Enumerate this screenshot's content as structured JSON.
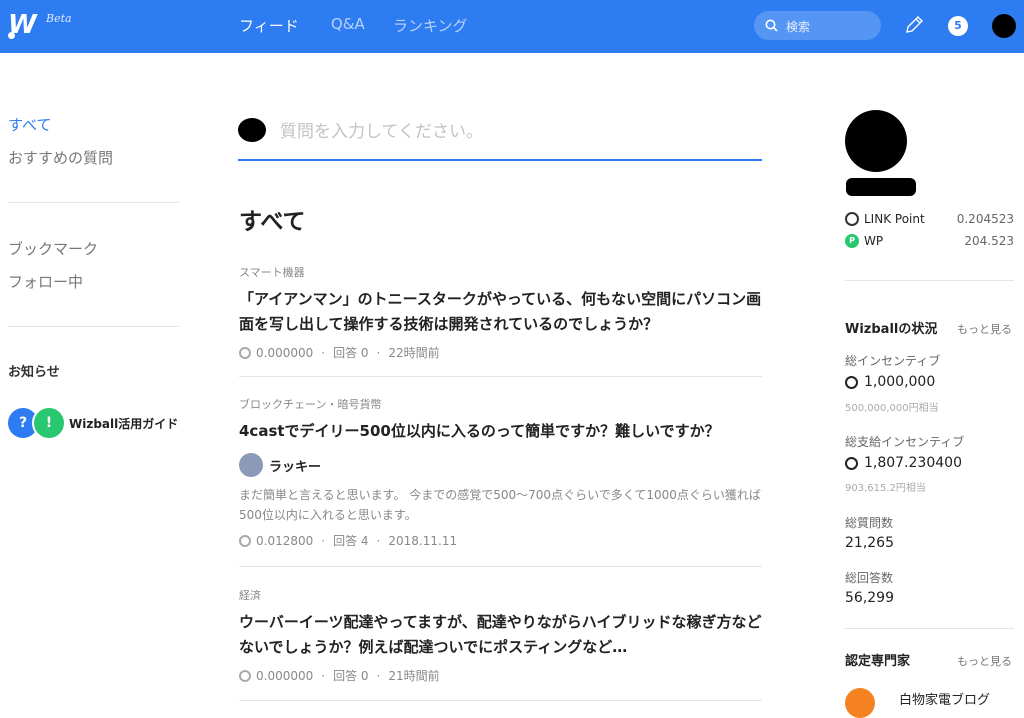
{
  "header": {
    "logo_beta": "Beta",
    "nav": [
      "フィード",
      "Q&A",
      "ランキング"
    ],
    "search_placeholder": "検索",
    "notification_count": "5"
  },
  "sidebar": {
    "items": [
      "すべて",
      "おすすめの質問",
      "ブックマーク",
      "フォロー中"
    ],
    "notice_title": "お知らせ",
    "guide_icon1": "?",
    "guide_icon2": "!",
    "guide_label": "Wizball活用ガイド"
  },
  "main": {
    "question_placeholder": "質問を入力してください。",
    "heading": "すべて",
    "posts": [
      {
        "category": "スマート機器",
        "title": "「アイアンマン」のトニースタークがやっている、何もない空間にパソコン画面を写し出して操作する技術は開発されているのでしょうか？",
        "points": "0.000000",
        "answers": "回答 0",
        "time": "22時間前"
      },
      {
        "category": "ブロックチェーン・暗号貨幣",
        "title": "4castでデイリー500位以内に入るのって簡単ですか？難しいですか？",
        "author": "ラッキー",
        "excerpt": "まだ簡単と言えると思います。 今までの感覚で500〜700点ぐらいで多くて1000点ぐらい獲れば500位以内に入れると思います。",
        "points": "0.012800",
        "answers": "回答 4",
        "time": "2018.11.11"
      },
      {
        "category": "経済",
        "title": "ウーバーイーツ配達やってますが、配達やりながらハイブリッドな稼ぎ方などないでしょうか？例えば配達ついでにポスティングなど…",
        "points": "0.000000",
        "answers": "回答 0",
        "time": "21時間前"
      }
    ]
  },
  "right": {
    "link_point_label": "LINK Point",
    "link_point_value": "0.204523",
    "wp_icon": "P",
    "wp_label": "WP",
    "wp_value": "204.523",
    "status_title": "Wizballの状況",
    "more_label": "もっと見る",
    "incentive_label": "総インセンティブ",
    "incentive_value": "1,000,000",
    "incentive_sub": "500,000,000円相当",
    "paid_label": "総支給インセンティブ",
    "paid_value": "1,807.230400",
    "paid_sub": "903,615.2円相当",
    "questions_label": "総質問数",
    "questions_value": "21,265",
    "answers_label": "総回答数",
    "answers_value": "56,299",
    "experts_title": "認定専門家",
    "experts_more": "もっと見る",
    "expert_name": "白物家電ブログ"
  }
}
